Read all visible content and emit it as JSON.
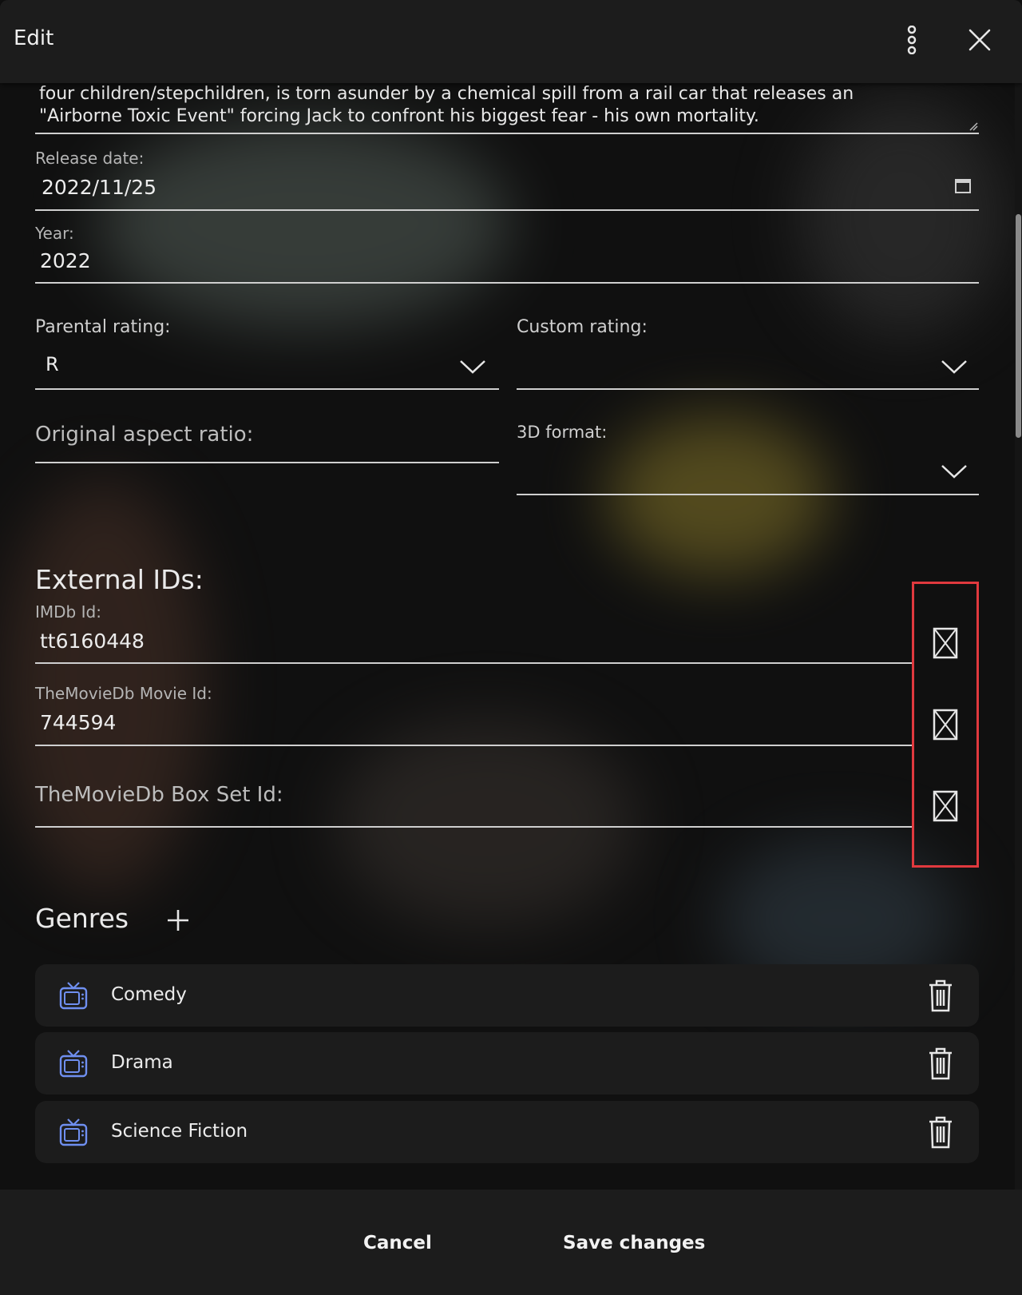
{
  "header": {
    "title": "Edit"
  },
  "overview": {
    "text": "four children/stepchildren, is torn asunder by a chemical spill from a rail car that releases an \"Airborne Toxic Event\" forcing Jack to confront his biggest fear - his own mortality."
  },
  "fields": {
    "release_date": {
      "label": "Release date:",
      "value": "2022/11/25"
    },
    "year": {
      "label": "Year:",
      "value": "2022"
    },
    "parental_rating": {
      "label": "Parental rating:",
      "value": "R"
    },
    "custom_rating": {
      "label": "Custom rating:",
      "value": ""
    },
    "aspect_ratio": {
      "label": "Original aspect ratio:",
      "value": ""
    },
    "format_3d": {
      "label": "3D format:",
      "value": ""
    }
  },
  "external_ids": {
    "title": "External IDs:",
    "imdb": {
      "label": "IMDb Id:",
      "value": "tt6160448"
    },
    "tmdb_movie": {
      "label": "TheMovieDb Movie Id:",
      "value": "744594"
    },
    "tmdb_boxset": {
      "label": "TheMovieDb Box Set Id:",
      "value": ""
    }
  },
  "genres": {
    "title": "Genres",
    "add_icon": "plus-icon",
    "items": [
      {
        "label": "Comedy",
        "icon": "tv-icon"
      },
      {
        "label": "Drama",
        "icon": "tv-icon"
      },
      {
        "label": "Science Fiction",
        "icon": "tv-icon"
      }
    ]
  },
  "footer": {
    "cancel": "Cancel",
    "save": "Save changes"
  },
  "colors": {
    "accent_icon": "#6f8ff0",
    "highlight": "#e0393e"
  }
}
